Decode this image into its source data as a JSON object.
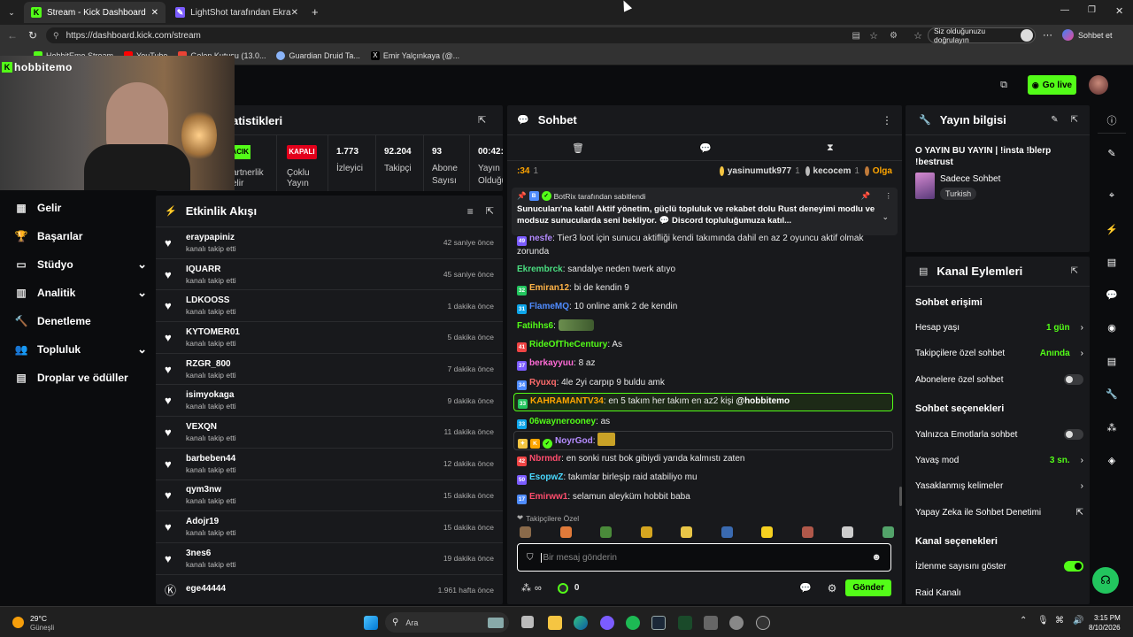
{
  "browser": {
    "tabs": [
      {
        "label": "Stream - Kick Dashboard",
        "active": true
      },
      {
        "label": "LightShot tarafından Ekran Görüntü",
        "active": false
      }
    ],
    "url": "https://dashboard.kick.com/stream",
    "verify_label": "Siz olduğunuzu doğrulayın",
    "copilot_label": "Sohbet et",
    "bookmarks": [
      "HobbitEmo Stream",
      "YouTube",
      "Gelen Kutusu (13.0...",
      "Guardian Druid Ta...",
      "Emir Yalçınkaya (@..."
    ]
  },
  "header": {
    "channel": "hobbitemo",
    "go_live": "Go live"
  },
  "stats": {
    "title": "atistikleri",
    "items": [
      {
        "badge": "ACIK",
        "label1": "artnerlik",
        "label2": "elir"
      },
      {
        "badge": "KAPALI",
        "label1": "Çoklu",
        "label2": "Yayın"
      },
      {
        "value": "1.773",
        "label1": "İzleyici",
        "label2": ""
      },
      {
        "value": "92.204",
        "label1": "Takipçi",
        "label2": ""
      },
      {
        "value": "93",
        "label1": "Abone",
        "label2": "Sayısı"
      },
      {
        "value": "00:42:",
        "label1": "Yayın",
        "label2": "Olduğu"
      }
    ]
  },
  "sidebar": {
    "items": [
      {
        "label": "Gelir",
        "icon": "revenue-icon",
        "expand": false
      },
      {
        "label": "Başarılar",
        "icon": "trophy-icon",
        "expand": false
      },
      {
        "label": "Stüdyo",
        "icon": "studio-icon",
        "expand": true
      },
      {
        "label": "Analitik",
        "icon": "analytics-icon",
        "expand": true
      },
      {
        "label": "Denetleme",
        "icon": "moderation-icon",
        "expand": false
      },
      {
        "label": "Topluluk",
        "icon": "community-icon",
        "expand": true
      },
      {
        "label": "Droplar ve ödüller",
        "icon": "drops-icon",
        "expand": false
      }
    ]
  },
  "activity": {
    "title": "Etkinlik Akışı",
    "events": [
      {
        "name": "eraypapiniz",
        "action": "kanalı takip etti",
        "time": "42 saniye önce"
      },
      {
        "name": "IQUARR",
        "action": "kanalı takip etti",
        "time": "45 saniye önce"
      },
      {
        "name": "LDKOOSS",
        "action": "kanalı takip etti",
        "time": "1 dakika önce"
      },
      {
        "name": "KYTOMER01",
        "action": "kanalı takip etti",
        "time": "5 dakika önce"
      },
      {
        "name": "RZGR_800",
        "action": "kanalı takip etti",
        "time": "7 dakika önce"
      },
      {
        "name": "isimyokaga",
        "action": "kanalı takip etti",
        "time": "9 dakika önce"
      },
      {
        "name": "VEXQN",
        "action": "kanalı takip etti",
        "time": "11 dakika önce"
      },
      {
        "name": "barbeben44",
        "action": "kanalı takip etti",
        "time": "12 dakika önce"
      },
      {
        "name": "qym3nw",
        "action": "kanalı takip etti",
        "time": "15 dakika önce"
      },
      {
        "name": "Adojr19",
        "action": "kanalı takip etti",
        "time": "15 dakika önce"
      },
      {
        "name": "3nes6",
        "action": "kanalı takip etti",
        "time": "19 dakika önce"
      },
      {
        "name": "ege44444",
        "action": "",
        "time": "1.961 hafta önce"
      }
    ]
  },
  "chat": {
    "title": "Sohbet",
    "top_gifters": [
      {
        "prefix": ":34",
        "count": "1"
      },
      {
        "name": "yasinumutk977",
        "count": "1"
      },
      {
        "name": "kecocem",
        "count": "1"
      },
      {
        "name": "Olga"
      }
    ],
    "pinned": {
      "by": "BotRix tarafından sabitlendi",
      "text": "Sunucuları'na katıl! Aktif yönetim, güçlü topluluk ve rekabet dolu Rust deneyimi modlu ve modsuz sunucularda seni bekliyor. 💬 Discord topluluğumuza katıl..."
    },
    "messages": [
      {
        "user": "nesfe",
        "color": "#b58cff",
        "badge": "49",
        "text": "Tier3 loot için sunucu aktifliği kendi takımında dahil en az 2 oyuncu aktif olmak zorunda"
      },
      {
        "user": "Ekrembrck",
        "color": "#4ade80",
        "badge": "",
        "text": "sandalye neden twerk atıyo"
      },
      {
        "user": "Emiran12",
        "color": "#ffb347",
        "badge": "32",
        "text": "bi de kendin 9"
      },
      {
        "user": "FlameMQ",
        "color": "#4f8cff",
        "badge": "31",
        "text": "10 online amk 2 de kendin"
      },
      {
        "user": "Fatihhs6",
        "color": "#53fc18",
        "badge": "",
        "text": ""
      },
      {
        "user": "RideOfTheCentury",
        "color": "#53fc18",
        "badge": "41",
        "text": "As"
      },
      {
        "user": "berkayyuu",
        "color": "#ff6bd6",
        "badge": "37",
        "text": "8 az"
      },
      {
        "user": "Ryuxq",
        "color": "#ff6b6b",
        "badge": "34",
        "text": "4le 2yi carpıp 9 buldu amk"
      },
      {
        "user": "KAHRAMANTV34",
        "color": "#ffa500",
        "badge": "33",
        "text": "en 5 takım her takım en az2 kişi",
        "mention": "@hobbitemo"
      },
      {
        "user": "06waynerooney",
        "color": "#53fc18",
        "badge": "33",
        "text": "as"
      },
      {
        "user": "NoyrGod",
        "color": "#b58cff",
        "badge": "",
        "text": ""
      },
      {
        "user": "Nbrmdr",
        "color": "#ff4d6d",
        "badge": "42",
        "text": "en sonki rust bok gibiydi yarıda kalmıstı zaten"
      },
      {
        "user": "EsopwZ",
        "color": "#4ad9ff",
        "badge": "50",
        "text": "takımlar birleşip raid atabiliyo mu"
      },
      {
        "user": "Emirww1",
        "color": "#ff4d6d",
        "badge": "17",
        "text": "selamun aleyküm hobbit baba"
      }
    ],
    "emote_label": "Takipçilere Özel",
    "input_placeholder": "Bir mesaj gönderin",
    "points": "0",
    "send_label": "Gönder"
  },
  "stream_info": {
    "title": "Yayın bilgisi",
    "stream_title": "O YAYIN BU YAYIN | !insta !blerp !bestrust",
    "category": "Sadece Sohbet",
    "tag": "Turkish"
  },
  "channel_actions": {
    "title": "Kanal Eylemleri",
    "section1": "Sohbet erişimi",
    "account_age": {
      "label": "Hesap yaşı",
      "value": "1 gün"
    },
    "followers_only": {
      "label": "Takipçilere özel sohbet",
      "value": "Anında"
    },
    "subscribers_only": {
      "label": "Abonelere özel sohbet"
    },
    "section2": "Sohbet seçenekleri",
    "emote_only": {
      "label": "Yalnızca Emotlarla sohbet"
    },
    "slow_mode": {
      "label": "Yavaş mod",
      "value": "3 sn."
    },
    "banned_words": {
      "label": "Yasaklanmış kelimeler"
    },
    "ai_moderation": {
      "label": "Yapay Zeka ile Sohbet Denetimi"
    },
    "section3": "Kanal seçenekleri",
    "show_viewers": {
      "label": "İzlenme sayısını göster"
    },
    "raid": {
      "label": "Raid Kanalı"
    }
  },
  "taskbar": {
    "weather_temp": "29°C",
    "weather_desc": "Güneşli",
    "search": "Ara",
    "time": "3:15 PM",
    "date": "8/10/2026"
  },
  "colors": {
    "accent": "#53fc18",
    "panel": "#18191c",
    "bg": "#0b0c0e"
  }
}
